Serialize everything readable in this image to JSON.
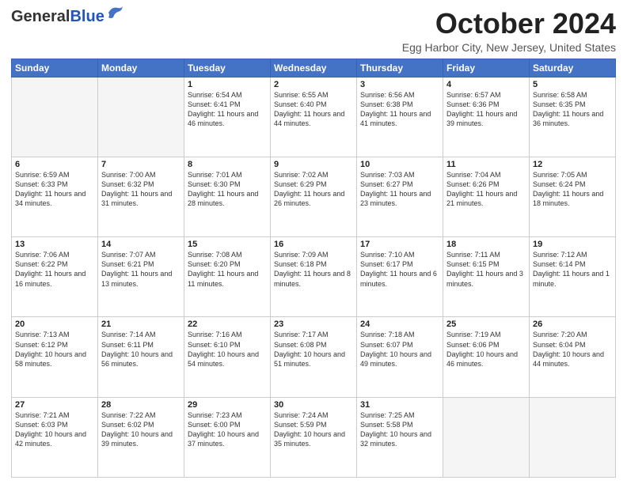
{
  "header": {
    "logo_general": "General",
    "logo_blue": "Blue",
    "month_title": "October 2024",
    "location": "Egg Harbor City, New Jersey, United States"
  },
  "weekdays": [
    "Sunday",
    "Monday",
    "Tuesday",
    "Wednesday",
    "Thursday",
    "Friday",
    "Saturday"
  ],
  "weeks": [
    [
      {
        "day": "",
        "sunrise": "",
        "sunset": "",
        "daylight": ""
      },
      {
        "day": "",
        "sunrise": "",
        "sunset": "",
        "daylight": ""
      },
      {
        "day": "1",
        "sunrise": "Sunrise: 6:54 AM",
        "sunset": "Sunset: 6:41 PM",
        "daylight": "Daylight: 11 hours and 46 minutes."
      },
      {
        "day": "2",
        "sunrise": "Sunrise: 6:55 AM",
        "sunset": "Sunset: 6:40 PM",
        "daylight": "Daylight: 11 hours and 44 minutes."
      },
      {
        "day": "3",
        "sunrise": "Sunrise: 6:56 AM",
        "sunset": "Sunset: 6:38 PM",
        "daylight": "Daylight: 11 hours and 41 minutes."
      },
      {
        "day": "4",
        "sunrise": "Sunrise: 6:57 AM",
        "sunset": "Sunset: 6:36 PM",
        "daylight": "Daylight: 11 hours and 39 minutes."
      },
      {
        "day": "5",
        "sunrise": "Sunrise: 6:58 AM",
        "sunset": "Sunset: 6:35 PM",
        "daylight": "Daylight: 11 hours and 36 minutes."
      }
    ],
    [
      {
        "day": "6",
        "sunrise": "Sunrise: 6:59 AM",
        "sunset": "Sunset: 6:33 PM",
        "daylight": "Daylight: 11 hours and 34 minutes."
      },
      {
        "day": "7",
        "sunrise": "Sunrise: 7:00 AM",
        "sunset": "Sunset: 6:32 PM",
        "daylight": "Daylight: 11 hours and 31 minutes."
      },
      {
        "day": "8",
        "sunrise": "Sunrise: 7:01 AM",
        "sunset": "Sunset: 6:30 PM",
        "daylight": "Daylight: 11 hours and 28 minutes."
      },
      {
        "day": "9",
        "sunrise": "Sunrise: 7:02 AM",
        "sunset": "Sunset: 6:29 PM",
        "daylight": "Daylight: 11 hours and 26 minutes."
      },
      {
        "day": "10",
        "sunrise": "Sunrise: 7:03 AM",
        "sunset": "Sunset: 6:27 PM",
        "daylight": "Daylight: 11 hours and 23 minutes."
      },
      {
        "day": "11",
        "sunrise": "Sunrise: 7:04 AM",
        "sunset": "Sunset: 6:26 PM",
        "daylight": "Daylight: 11 hours and 21 minutes."
      },
      {
        "day": "12",
        "sunrise": "Sunrise: 7:05 AM",
        "sunset": "Sunset: 6:24 PM",
        "daylight": "Daylight: 11 hours and 18 minutes."
      }
    ],
    [
      {
        "day": "13",
        "sunrise": "Sunrise: 7:06 AM",
        "sunset": "Sunset: 6:22 PM",
        "daylight": "Daylight: 11 hours and 16 minutes."
      },
      {
        "day": "14",
        "sunrise": "Sunrise: 7:07 AM",
        "sunset": "Sunset: 6:21 PM",
        "daylight": "Daylight: 11 hours and 13 minutes."
      },
      {
        "day": "15",
        "sunrise": "Sunrise: 7:08 AM",
        "sunset": "Sunset: 6:20 PM",
        "daylight": "Daylight: 11 hours and 11 minutes."
      },
      {
        "day": "16",
        "sunrise": "Sunrise: 7:09 AM",
        "sunset": "Sunset: 6:18 PM",
        "daylight": "Daylight: 11 hours and 8 minutes."
      },
      {
        "day": "17",
        "sunrise": "Sunrise: 7:10 AM",
        "sunset": "Sunset: 6:17 PM",
        "daylight": "Daylight: 11 hours and 6 minutes."
      },
      {
        "day": "18",
        "sunrise": "Sunrise: 7:11 AM",
        "sunset": "Sunset: 6:15 PM",
        "daylight": "Daylight: 11 hours and 3 minutes."
      },
      {
        "day": "19",
        "sunrise": "Sunrise: 7:12 AM",
        "sunset": "Sunset: 6:14 PM",
        "daylight": "Daylight: 11 hours and 1 minute."
      }
    ],
    [
      {
        "day": "20",
        "sunrise": "Sunrise: 7:13 AM",
        "sunset": "Sunset: 6:12 PM",
        "daylight": "Daylight: 10 hours and 58 minutes."
      },
      {
        "day": "21",
        "sunrise": "Sunrise: 7:14 AM",
        "sunset": "Sunset: 6:11 PM",
        "daylight": "Daylight: 10 hours and 56 minutes."
      },
      {
        "day": "22",
        "sunrise": "Sunrise: 7:16 AM",
        "sunset": "Sunset: 6:10 PM",
        "daylight": "Daylight: 10 hours and 54 minutes."
      },
      {
        "day": "23",
        "sunrise": "Sunrise: 7:17 AM",
        "sunset": "Sunset: 6:08 PM",
        "daylight": "Daylight: 10 hours and 51 minutes."
      },
      {
        "day": "24",
        "sunrise": "Sunrise: 7:18 AM",
        "sunset": "Sunset: 6:07 PM",
        "daylight": "Daylight: 10 hours and 49 minutes."
      },
      {
        "day": "25",
        "sunrise": "Sunrise: 7:19 AM",
        "sunset": "Sunset: 6:06 PM",
        "daylight": "Daylight: 10 hours and 46 minutes."
      },
      {
        "day": "26",
        "sunrise": "Sunrise: 7:20 AM",
        "sunset": "Sunset: 6:04 PM",
        "daylight": "Daylight: 10 hours and 44 minutes."
      }
    ],
    [
      {
        "day": "27",
        "sunrise": "Sunrise: 7:21 AM",
        "sunset": "Sunset: 6:03 PM",
        "daylight": "Daylight: 10 hours and 42 minutes."
      },
      {
        "day": "28",
        "sunrise": "Sunrise: 7:22 AM",
        "sunset": "Sunset: 6:02 PM",
        "daylight": "Daylight: 10 hours and 39 minutes."
      },
      {
        "day": "29",
        "sunrise": "Sunrise: 7:23 AM",
        "sunset": "Sunset: 6:00 PM",
        "daylight": "Daylight: 10 hours and 37 minutes."
      },
      {
        "day": "30",
        "sunrise": "Sunrise: 7:24 AM",
        "sunset": "Sunset: 5:59 PM",
        "daylight": "Daylight: 10 hours and 35 minutes."
      },
      {
        "day": "31",
        "sunrise": "Sunrise: 7:25 AM",
        "sunset": "Sunset: 5:58 PM",
        "daylight": "Daylight: 10 hours and 32 minutes."
      },
      {
        "day": "",
        "sunrise": "",
        "sunset": "",
        "daylight": ""
      },
      {
        "day": "",
        "sunrise": "",
        "sunset": "",
        "daylight": ""
      }
    ]
  ]
}
